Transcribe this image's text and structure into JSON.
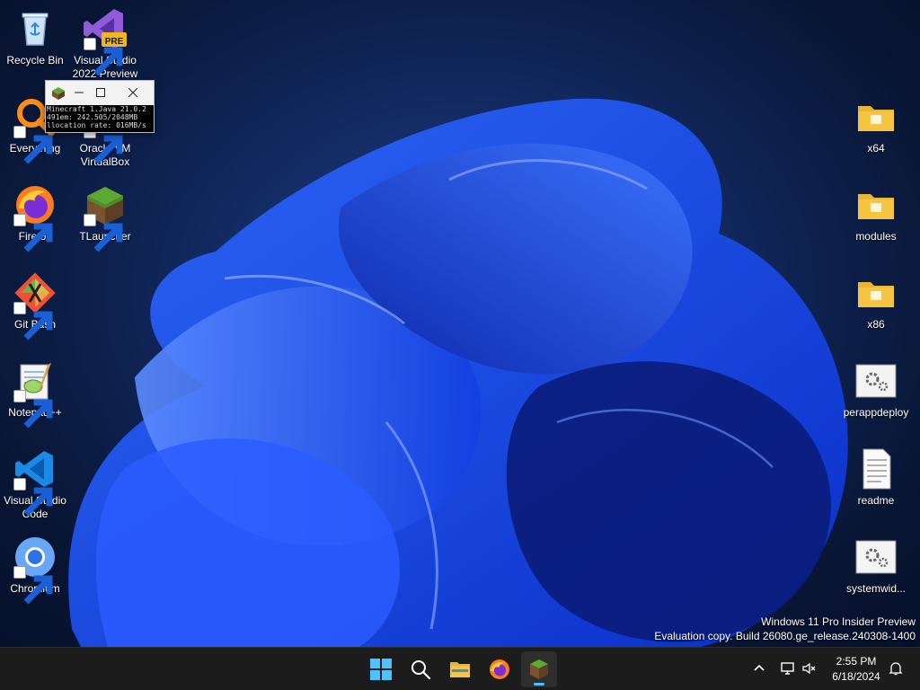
{
  "desktop_icons": {
    "recycle_bin": "Recycle Bin",
    "visual_studio_preview": "Visual Studio 2022 Preview",
    "visual_studio_preview_badge": "PRE",
    "everything": "Everything",
    "virtualbox": "Oracle VM VirtualBox",
    "firefox": "Firefox",
    "tlauncher": "TLauncher",
    "git_bash": "Git Bash",
    "notepadpp": "Notepad++",
    "vscode": "Visual Studio Code",
    "chromium": "Chromium",
    "x64": "x64",
    "modules": "modules",
    "x86": "x86",
    "perappdeploy": "perappdeploy",
    "readme": "readme",
    "systemwide": "systemwid..."
  },
  "minecraft_window": {
    "lines": [
      "Minecraft 1.Java 21.0.2",
      "491em: 242.505/2048MB",
      "llocation rate: 016MB/s"
    ]
  },
  "watermark": {
    "line1": "Windows 11 Pro Insider Preview",
    "line2": "Evaluation copy. Build 26080.ge_release.240308-1400"
  },
  "taskbar": {
    "time": "2:55 PM",
    "date": "6/18/2024"
  },
  "colors": {
    "accent": "#4cc2ff",
    "taskbar_bg": "#1c1c1c",
    "folder": "#f5c542"
  }
}
